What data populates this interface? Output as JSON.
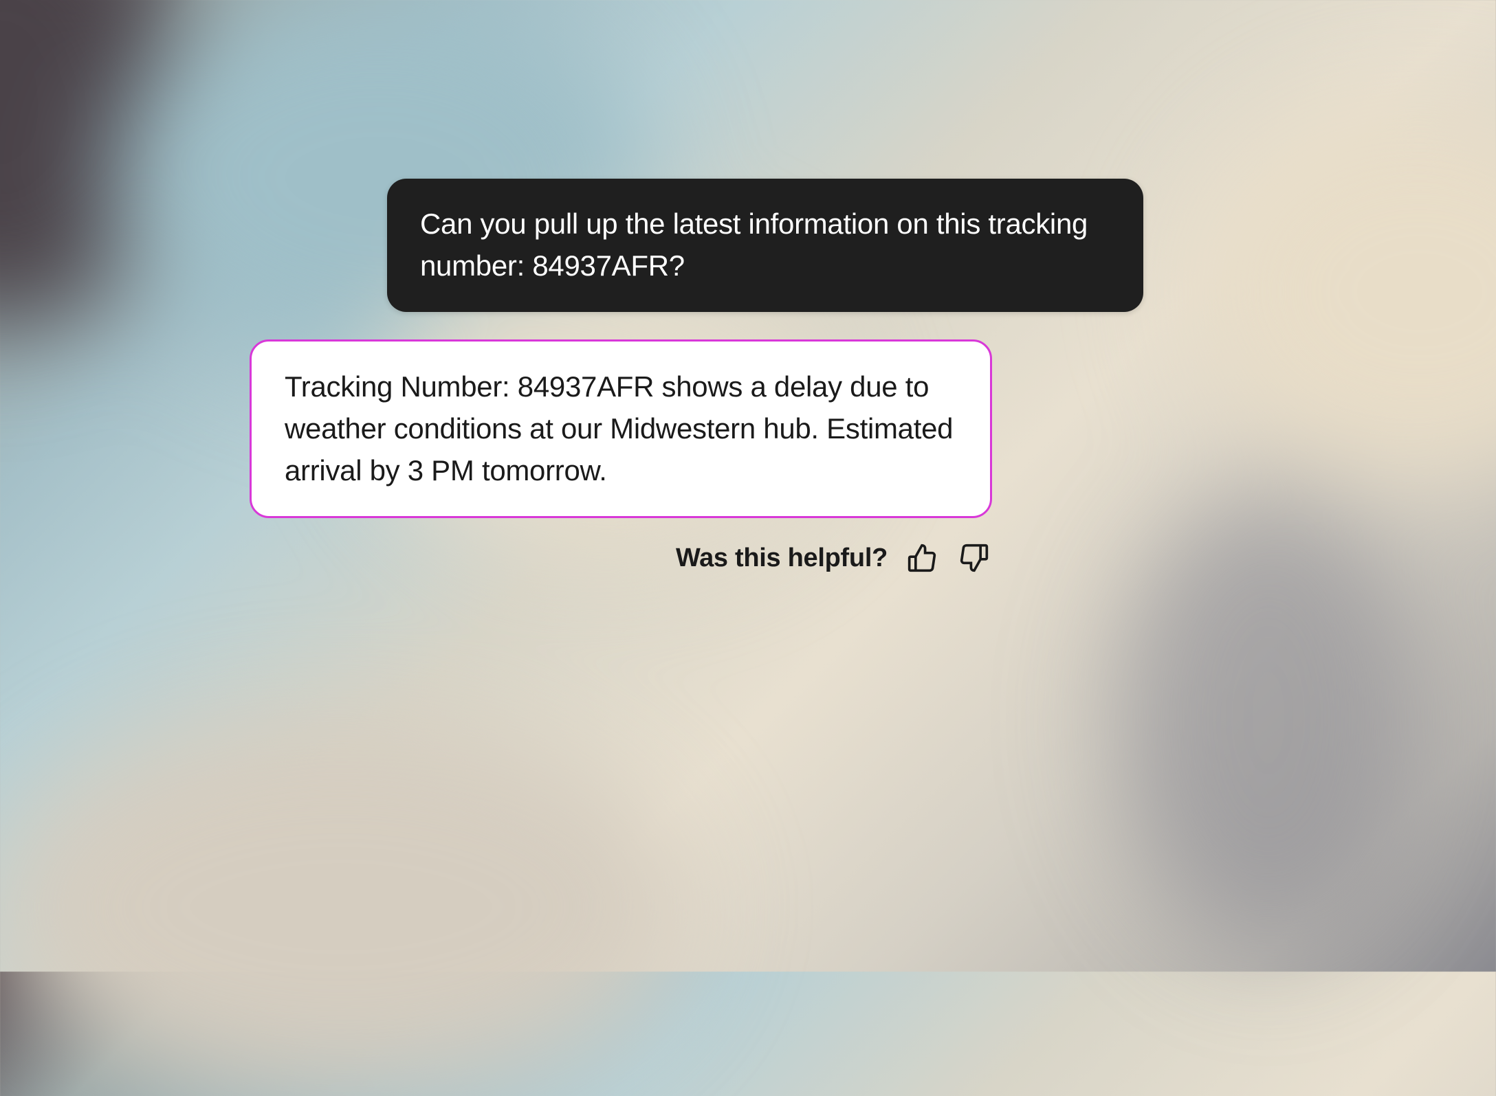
{
  "chat": {
    "user_message": "Can you pull up the latest information on this tracking number: 84937AFR?",
    "assistant_message": "Tracking Number: 84937AFR shows a delay due to weather conditions at our Midwestern hub. Estimated arrival by 3 PM tomorrow."
  },
  "feedback": {
    "prompt": "Was this helpful?"
  }
}
